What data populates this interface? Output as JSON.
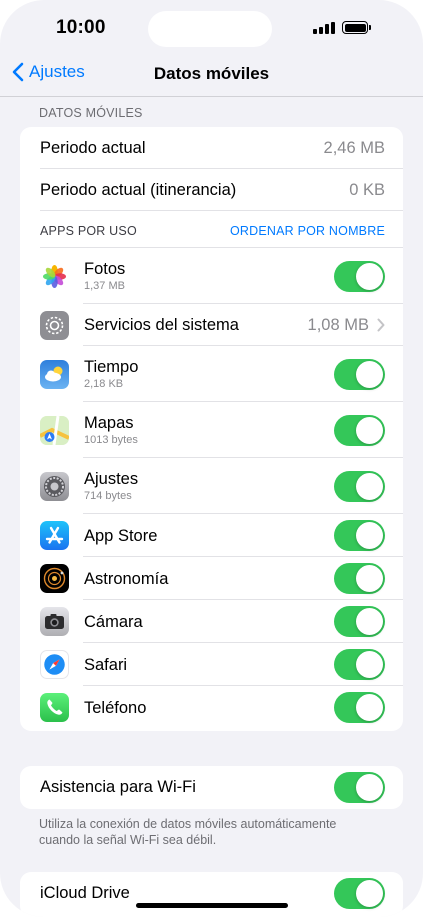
{
  "status_bar": {
    "time": "10:00"
  },
  "nav": {
    "back_label": "Ajustes",
    "title": "Datos móviles"
  },
  "usage_section": {
    "header": "DATOS MÓVILES",
    "rows": [
      {
        "label": "Periodo actual",
        "value": "2,46 MB"
      },
      {
        "label": "Periodo actual (itinerancia)",
        "value": "0 KB"
      }
    ],
    "apps_header": "APPS POR USO",
    "sort_label": "ORDENAR POR NOMBRE"
  },
  "apps": [
    {
      "name": "Fotos",
      "usage": "1,37 MB",
      "icon": "photos-icon",
      "toggle_on": true
    },
    {
      "name": "Servicios del sistema",
      "value": "1,08 MB",
      "icon": "settings-gear-icon"
    },
    {
      "name": "Tiempo",
      "usage": "2,18 KB",
      "icon": "weather-icon",
      "toggle_on": true
    },
    {
      "name": "Mapas",
      "usage": "1013 bytes",
      "icon": "maps-icon",
      "toggle_on": true
    },
    {
      "name": "Ajustes",
      "usage": "714 bytes",
      "icon": "settings-icon",
      "toggle_on": true
    },
    {
      "name": "App Store",
      "icon": "app-store-icon",
      "toggle_on": true
    },
    {
      "name": "Astronomía",
      "icon": "astronomy-icon",
      "toggle_on": true
    },
    {
      "name": "Cámara",
      "icon": "camera-icon",
      "toggle_on": true
    },
    {
      "name": "Safari",
      "icon": "safari-icon",
      "toggle_on": true
    },
    {
      "name": "Teléfono",
      "icon": "phone-icon",
      "toggle_on": true
    }
  ],
  "wifi_assist": {
    "label": "Asistencia para Wi-Fi",
    "toggle_on": true,
    "footnote": "Utiliza la conexión de datos móviles automáticamente cuando la señal Wi-Fi sea débil."
  },
  "icloud": {
    "label": "iCloud Drive",
    "toggle_on": true
  },
  "colors": {
    "accent": "#007aff",
    "toggle_on": "#34c759",
    "background": "#f2f2f7"
  }
}
